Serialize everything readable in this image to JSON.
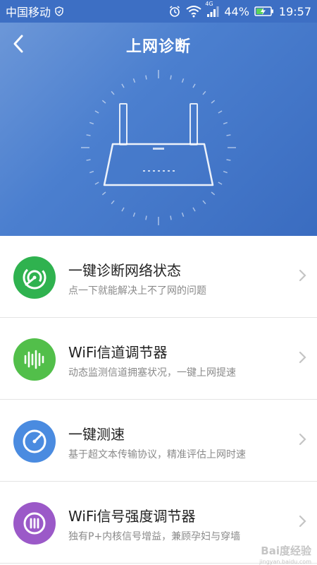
{
  "status_bar": {
    "carrier": "中国移动",
    "network": "4G",
    "battery": "44%",
    "time": "19:57"
  },
  "header": {
    "title": "上网诊断",
    "back_icon": "chevron-left-icon"
  },
  "colors": {
    "header_blue": "#4a7dcc",
    "green": "#2fb24f",
    "light_green": "#52bf4a",
    "blue": "#4a8be0",
    "purple": "#9b59c8"
  },
  "items": [
    {
      "title": "一键诊断网络状态",
      "subtitle": "点一下就能解决上不了网的问题",
      "icon": "diagnose-icon"
    },
    {
      "title": "WiFi信道调节器",
      "subtitle": "动态监测信道拥塞状况，一键上网提速",
      "icon": "channel-icon"
    },
    {
      "title": "一键测速",
      "subtitle": "基于超文本传输协议，精准评估上网时速",
      "icon": "speedometer-icon"
    },
    {
      "title": "WiFi信号强度调节器",
      "subtitle": "独有P+内核信号增益，兼顾孕妇与穿墙",
      "icon": "signal-boost-icon"
    }
  ],
  "watermark": {
    "text": "Bai度经验",
    "url": "jingyan.baidu.com"
  }
}
